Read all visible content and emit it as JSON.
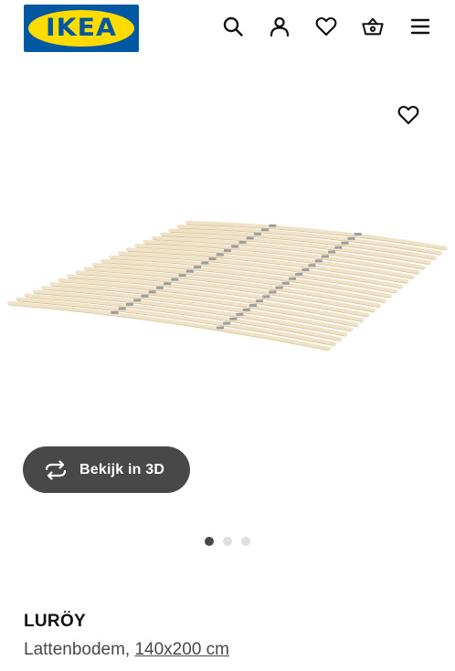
{
  "header": {
    "logo_text": "IKEA",
    "icons": [
      "search-icon",
      "account-icon",
      "heart-icon",
      "basket-icon",
      "menu-icon"
    ]
  },
  "hero": {
    "view_3d_label": "Bekijk in 3D",
    "carousel": {
      "total": 3,
      "active": 1
    }
  },
  "product": {
    "name": "LURÖY",
    "type": "Lattenbodem,",
    "size": "140x200 cm"
  },
  "colors": {
    "brand_blue": "#0058a3",
    "brand_yellow": "#ffdb00",
    "button_dark": "#484848",
    "slat_wood": "#efe2c6"
  }
}
